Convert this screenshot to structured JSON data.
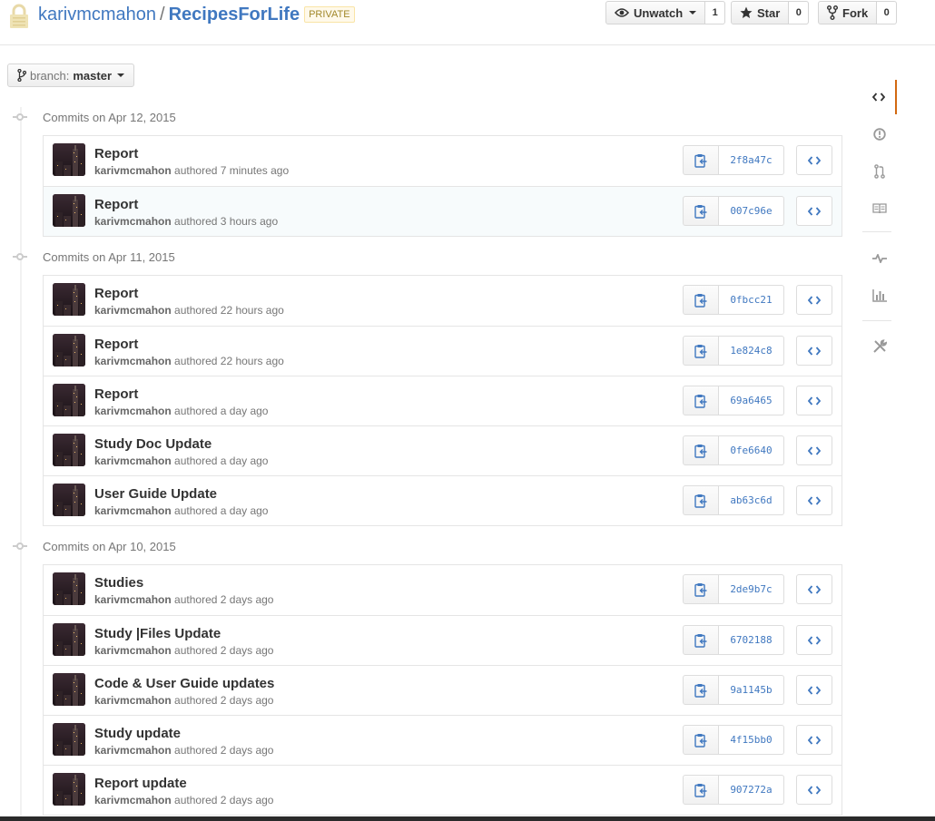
{
  "header": {
    "owner": "karivmcmahon",
    "separator": "/",
    "repo": "RecipesForLife",
    "badge": "PRIVATE",
    "watch": {
      "label": "Unwatch",
      "count": "1"
    },
    "star": {
      "label": "Star",
      "count": "0"
    },
    "fork": {
      "label": "Fork",
      "count": "0"
    }
  },
  "branch": {
    "label": "branch:",
    "name": "master"
  },
  "groups": [
    {
      "heading": "Commits on Apr 12, 2015",
      "commits": [
        {
          "message": "Report",
          "author": "karivmcmahon",
          "verb": "authored",
          "time": "7 minutes ago",
          "sha": "2f8a47c"
        },
        {
          "message": "Report",
          "author": "karivmcmahon",
          "verb": "authored",
          "time": "3 hours ago",
          "sha": "007c96e"
        }
      ]
    },
    {
      "heading": "Commits on Apr 11, 2015",
      "commits": [
        {
          "message": "Report",
          "author": "karivmcmahon",
          "verb": "authored",
          "time": "22 hours ago",
          "sha": "0fbcc21"
        },
        {
          "message": "Report",
          "author": "karivmcmahon",
          "verb": "authored",
          "time": "22 hours ago",
          "sha": "1e824c8"
        },
        {
          "message": "Report",
          "author": "karivmcmahon",
          "verb": "authored",
          "time": "a day ago",
          "sha": "69a6465"
        },
        {
          "message": "Study Doc Update",
          "author": "karivmcmahon",
          "verb": "authored",
          "time": "a day ago",
          "sha": "0fe6640"
        },
        {
          "message": "User Guide Update",
          "author": "karivmcmahon",
          "verb": "authored",
          "time": "a day ago",
          "sha": "ab63c6d"
        }
      ]
    },
    {
      "heading": "Commits on Apr 10, 2015",
      "commits": [
        {
          "message": "Studies",
          "author": "karivmcmahon",
          "verb": "authored",
          "time": "2 days ago",
          "sha": "2de9b7c"
        },
        {
          "message": "Study |Files Update",
          "author": "karivmcmahon",
          "verb": "authored",
          "time": "2 days ago",
          "sha": "6702188"
        },
        {
          "message": "Code & User Guide updates",
          "author": "karivmcmahon",
          "verb": "authored",
          "time": "2 days ago",
          "sha": "9a1145b"
        },
        {
          "message": "Study update",
          "author": "karivmcmahon",
          "verb": "authored",
          "time": "2 days ago",
          "sha": "4f15bb0"
        },
        {
          "message": "Report update",
          "author": "karivmcmahon",
          "verb": "authored",
          "time": "2 days ago",
          "sha": "907272a"
        }
      ]
    }
  ],
  "sidebar": {
    "items": [
      "code-icon",
      "issues-icon",
      "pull-request-icon",
      "wiki-icon",
      "pulse-icon",
      "graphs-icon",
      "settings-icon"
    ],
    "selected": "code-icon"
  },
  "colors": {
    "link": "#4078c0",
    "badge_text": "#a1882b",
    "badge_bg": "#fff9ea",
    "selected_tab": "#d26911",
    "muted_text": "#767676",
    "icon_gray": "#999999"
  }
}
